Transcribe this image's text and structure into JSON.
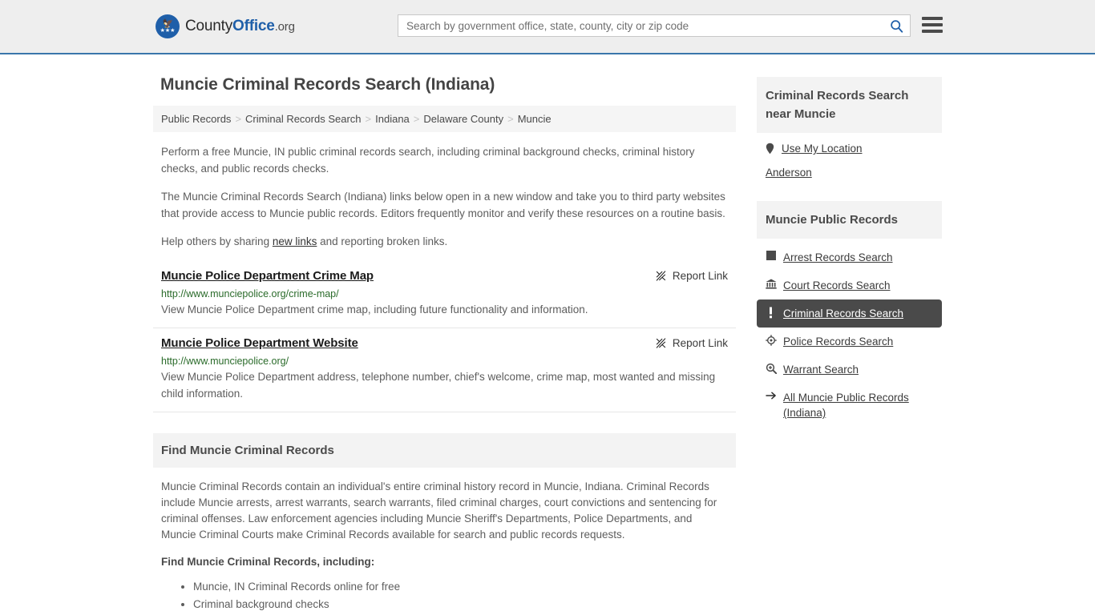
{
  "header": {
    "logo": {
      "name_part1": "County",
      "name_part2": "Office",
      "name_part3": ".org",
      "mark_icon": "eagle-seal-icon"
    },
    "search": {
      "placeholder": "Search by government office, state, county, city or zip code",
      "value": "",
      "button_icon": "search-icon"
    },
    "menu_icon": "hamburger-menu-icon"
  },
  "page": {
    "title": "Muncie Criminal Records Search (Indiana)"
  },
  "breadcrumb": {
    "separator": ">",
    "items": [
      {
        "label": "Public Records"
      },
      {
        "label": "Criminal Records Search"
      },
      {
        "label": "Indiana"
      },
      {
        "label": "Delaware County"
      },
      {
        "label": "Muncie"
      }
    ]
  },
  "intro": {
    "paragraph1": "Perform a free Muncie, IN public criminal records search, including criminal background checks, criminal history checks, and public records checks.",
    "paragraph2": "The Muncie Criminal Records Search (Indiana) links below open in a new window and take you to third party websites that provide access to Muncie public records. Editors frequently monitor and verify these resources on a routine basis.",
    "paragraph3_before": "Help others by sharing ",
    "paragraph3_link": "new links",
    "paragraph3_after": " and reporting broken links."
  },
  "results": [
    {
      "title": "Muncie Police Department Crime Map",
      "url": "http://www.munciepolice.org/crime-map/",
      "description": "View Muncie Police Department crime map, including future functionality and information.",
      "report_label": "Report Link",
      "report_icon": "broken-link-icon"
    },
    {
      "title": "Muncie Police Department Website",
      "url": "http://www.munciepolice.org/",
      "description": "View Muncie Police Department address, telephone number, chief's welcome, crime map, most wanted and missing child information.",
      "report_label": "Report Link",
      "report_icon": "broken-link-icon"
    }
  ],
  "find_section": {
    "heading": "Find Muncie Criminal Records",
    "body": "Muncie Criminal Records contain an individual's entire criminal history record in Muncie, Indiana. Criminal Records include Muncie arrests, arrest warrants, search warrants, filed criminal charges, court convictions and sentencing for criminal offenses. Law enforcement agencies including Muncie Sheriff's Departments, Police Departments, and Muncie Criminal Courts make Criminal Records available for search and public records requests.",
    "lead": "Find Muncie Criminal Records, including:",
    "bullets": [
      "Muncie, IN Criminal Records online for free",
      "Criminal background checks"
    ]
  },
  "sidebar": {
    "near_box": {
      "heading": "Criminal Records Search near Muncie",
      "use_location_label": "Use My Location",
      "use_location_icon": "map-pin-icon",
      "cities": [
        {
          "label": "Anderson"
        }
      ]
    },
    "records_box": {
      "heading": "Muncie Public Records",
      "items": [
        {
          "label": "Arrest Records Search",
          "icon": "fingerprint-icon",
          "glyph": "■",
          "active": false
        },
        {
          "label": "Court Records Search",
          "icon": "courthouse-icon",
          "glyph": "🏛",
          "active": false
        },
        {
          "label": "Criminal Records Search",
          "icon": "exclamation-icon",
          "glyph": "❗",
          "active": true
        },
        {
          "label": "Police Records Search",
          "icon": "police-badge-icon",
          "glyph": "⊕",
          "active": false
        },
        {
          "label": "Warrant Search",
          "icon": "magnifier-plus-icon",
          "glyph": "⊕",
          "active": false
        },
        {
          "label": "All Muncie Public Records (Indiana)",
          "icon": "arrow-right-icon",
          "glyph": "→",
          "active": false
        }
      ]
    }
  },
  "colors": {
    "header_bg": "#eeeeee",
    "header_border": "#3a76ab",
    "brand_blue": "#1f5fa9",
    "url_green": "#2a6b2a",
    "active_item_bg": "#4a4a4a",
    "panel_gray": "#f3f3f3",
    "body_text": "#5d5d5d"
  }
}
